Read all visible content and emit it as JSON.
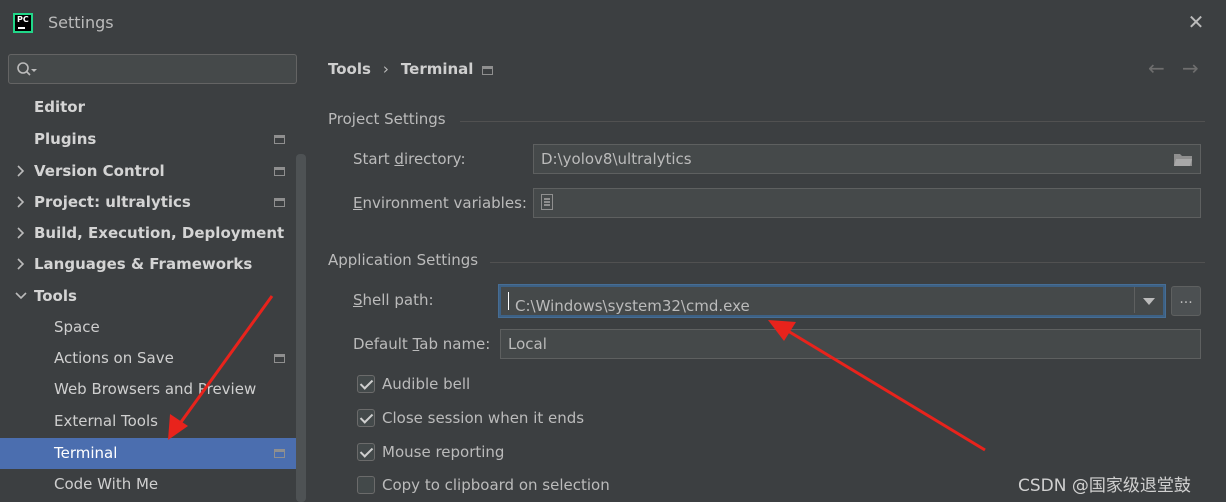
{
  "window": {
    "title": "Settings",
    "app_logo_text": "PC",
    "close_glyph": "✕"
  },
  "search": {
    "value": "",
    "placeholder": ""
  },
  "sidebar": {
    "items": [
      {
        "label": "Editor"
      },
      {
        "label": "Plugins"
      },
      {
        "label": "Version Control"
      },
      {
        "label": "Project: ultralytics"
      },
      {
        "label": "Build, Execution, Deployment"
      },
      {
        "label": "Languages & Frameworks"
      },
      {
        "label": "Tools"
      },
      {
        "label": "Space"
      },
      {
        "label": "Actions on Save"
      },
      {
        "label": "Web Browsers and Preview"
      },
      {
        "label": "External Tools"
      },
      {
        "label": "Terminal"
      },
      {
        "label": "Code With Me"
      }
    ]
  },
  "breadcrumb": {
    "parent": "Tools",
    "separator": "›",
    "current": "Terminal"
  },
  "nav": {
    "back": "←",
    "forward": "→"
  },
  "project_settings": {
    "title": "Project Settings",
    "start_directory": {
      "label_pre": "Start ",
      "label_key": "d",
      "label_post": "irectory:",
      "value": "D:\\yolov8\\ultralytics"
    },
    "environment_variables": {
      "label_key": "E",
      "label_post": "nvironment variables:",
      "value": ""
    }
  },
  "application_settings": {
    "title": "Application Settings",
    "shell_path": {
      "label_key": "S",
      "label_post": "hell path:",
      "value": "C:\\Windows\\system32\\cmd.exe",
      "browse_label": "..."
    },
    "default_tab_name": {
      "label_pre": "Default ",
      "label_key": "T",
      "label_post": "ab name:",
      "value": "Local"
    },
    "checkboxes": [
      {
        "label": "Audible bell",
        "checked": true
      },
      {
        "label": "Close session when it ends",
        "checked": true
      },
      {
        "label": "Mouse reporting",
        "checked": true
      },
      {
        "label": "Copy to clipboard on selection",
        "checked": false
      }
    ]
  },
  "watermark": "CSDN @国家级退堂鼓",
  "colors": {
    "background": "#3c3f41",
    "selection": "#4b6eaf",
    "annotation_arrow": "#e8231c"
  }
}
